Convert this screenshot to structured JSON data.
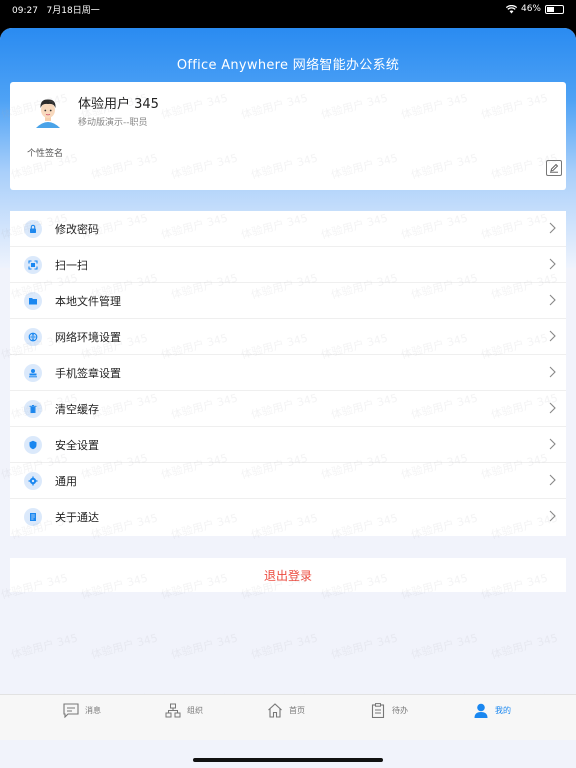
{
  "status_bar": {
    "time": "09:27",
    "date": "7月18日周一",
    "battery": "46%"
  },
  "header": {
    "title": "Office Anywhere  网络智能办公系统"
  },
  "profile": {
    "name": "体验用户 345",
    "role": "移动版演示--职员",
    "signature_label": "个性签名"
  },
  "menu": {
    "items": [
      {
        "label": "修改密码",
        "icon": "lock-icon"
      },
      {
        "label": "扫一扫",
        "icon": "scan-icon"
      },
      {
        "label": "本地文件管理",
        "icon": "folder-icon"
      },
      {
        "label": "网络环境设置",
        "icon": "network-icon"
      },
      {
        "label": "手机签章设置",
        "icon": "stamp-icon"
      },
      {
        "label": "清空缓存",
        "icon": "trash-icon"
      },
      {
        "label": "安全设置",
        "icon": "shield-icon"
      },
      {
        "label": "通用",
        "icon": "gear-icon"
      },
      {
        "label": "关于通达",
        "icon": "info-doc-icon"
      }
    ]
  },
  "logout": {
    "label": "退出登录"
  },
  "watermark_text": "体验用户 345",
  "tabs": [
    {
      "label": "消息",
      "icon": "message-icon"
    },
    {
      "label": "组织",
      "icon": "org-icon"
    },
    {
      "label": "首页",
      "icon": "home-icon"
    },
    {
      "label": "待办",
      "icon": "todo-icon"
    },
    {
      "label": "我的",
      "icon": "user-icon",
      "active": true
    }
  ],
  "colors": {
    "accent": "#1a87f0",
    "header_blue": "#2a8bf1",
    "logout_red": "#ec4a3e"
  }
}
